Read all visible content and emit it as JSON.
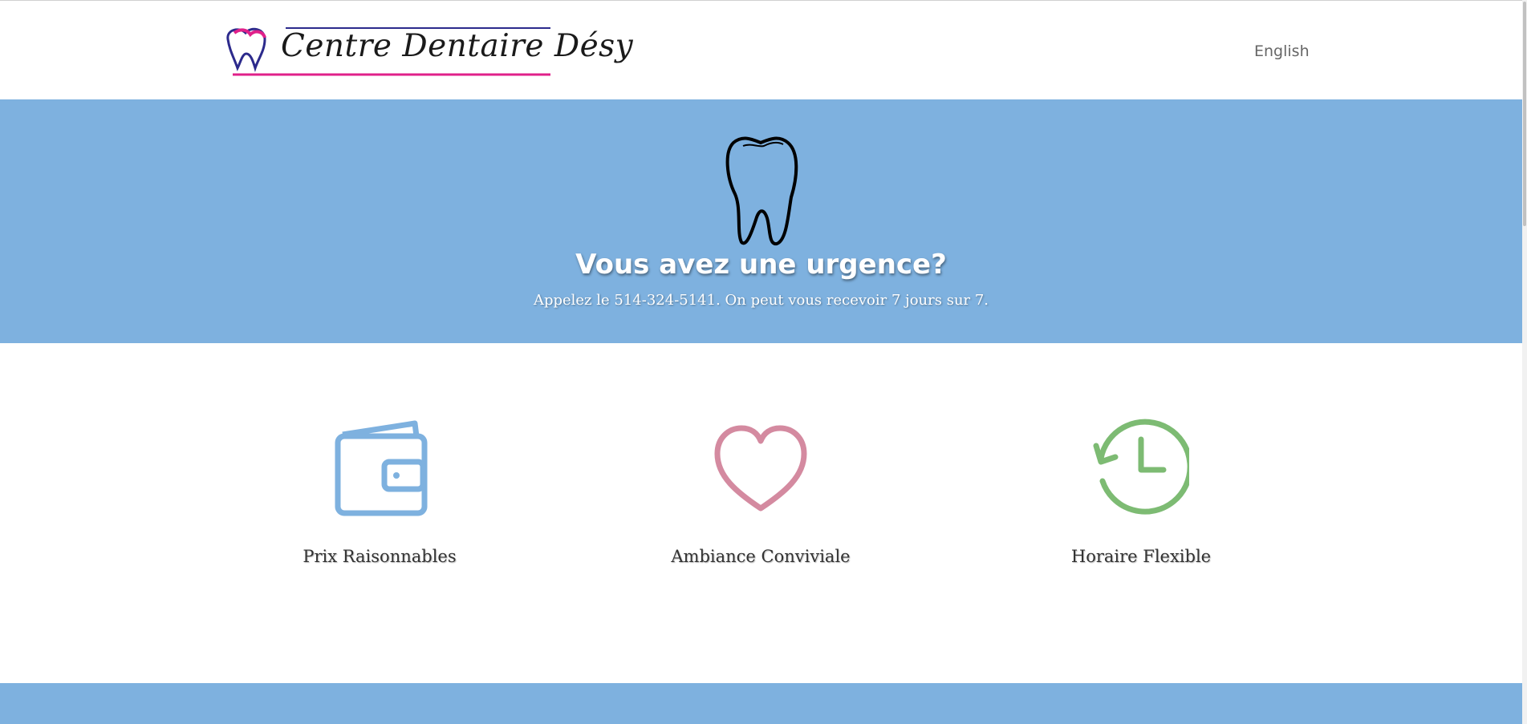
{
  "header": {
    "logo_text": "Centre Dentaire Désy",
    "language_link": "English"
  },
  "hero": {
    "title": "Vous avez une urgence?",
    "subtitle": "Appelez le 514-324-5141. On peut vous recevoir 7 jours sur 7."
  },
  "features": [
    {
      "label": "Prix Raisonnables",
      "icon": "wallet-icon",
      "color": "#7eb1df"
    },
    {
      "label": "Ambiance Conviviale",
      "icon": "heart-icon",
      "color": "#d48aa0"
    },
    {
      "label": "Horaire Flexible",
      "icon": "clock-history-icon",
      "color": "#7dbb73"
    }
  ],
  "colors": {
    "accent_blue": "#7eb1df",
    "logo_pink": "#e0208a",
    "logo_navy": "#2c2a8c"
  }
}
